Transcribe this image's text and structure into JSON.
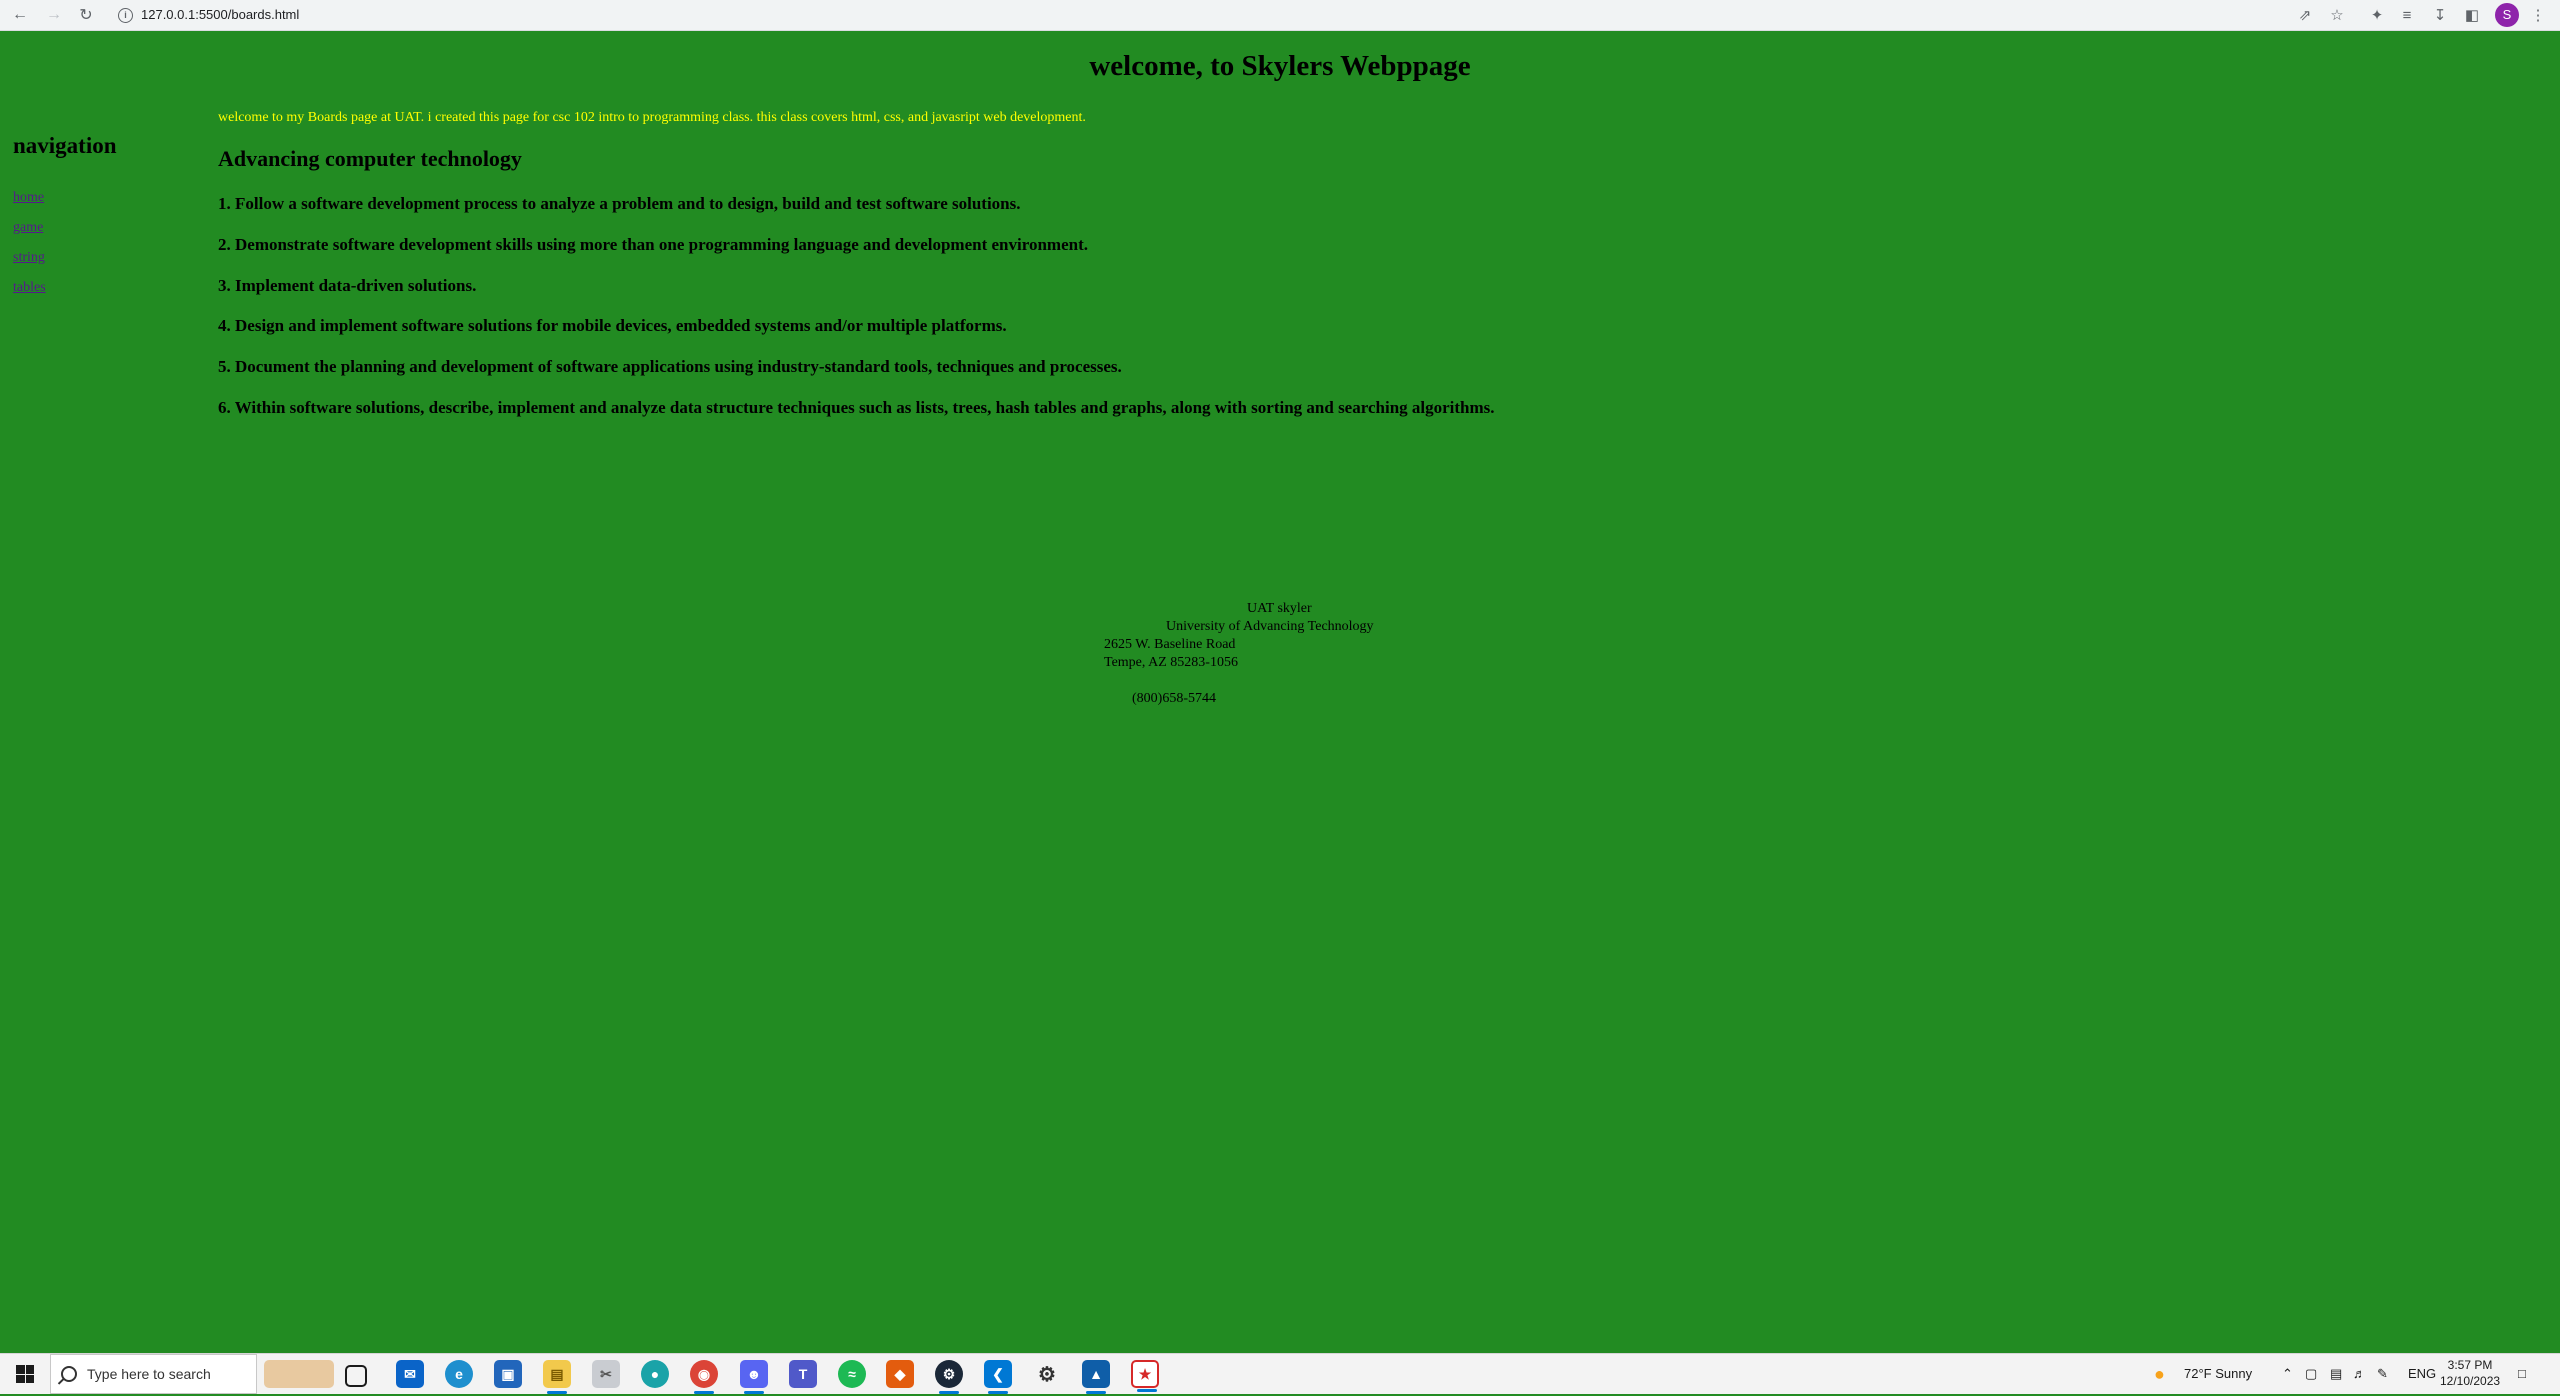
{
  "browser": {
    "url": "127.0.0.1:5500/boards.html"
  },
  "page": {
    "title": "welcome, to Skylers Webppage",
    "intro": "welcome to my Boards page at UAT. i created this page for csc 102 intro to programming class. this class covers html, css, and javasript web development.",
    "nav_heading": "navigation",
    "nav_links": [
      "home",
      "game",
      "string",
      "tables"
    ],
    "section_title": "Advancing computer technology",
    "outcomes": [
      "1. Follow a software development process to analyze a problem and to design, build and test software solutions.",
      "2. Demonstrate software development skills using more than one programming language and development environment.",
      "3. Implement data-driven solutions.",
      "4. Design and implement software solutions for mobile devices, embedded systems and/or multiple platforms.",
      "5. Document the planning and development of software applications using industry-standard tools, techniques and processes.",
      "6. Within software solutions, describe, implement and analyze data structure techniques such as lists, trees, hash tables and graphs, along with sorting and searching algorithms."
    ],
    "footer": {
      "name": "UAT skyler",
      "org": "University of Advancing Technology",
      "street": "2625 W. Baseline Road",
      "city": "Tempe, AZ 85283-1056",
      "phone": "(800)658-5744"
    }
  },
  "taskbar": {
    "search_placeholder": "Type here to search",
    "weather": "72°F  Sunny",
    "language": "ENG",
    "time": "3:57 PM",
    "date": "12/10/2023"
  },
  "colors": {
    "page_background": "#228b22",
    "intro_text": "#ffff00",
    "link": "#551a8b"
  }
}
